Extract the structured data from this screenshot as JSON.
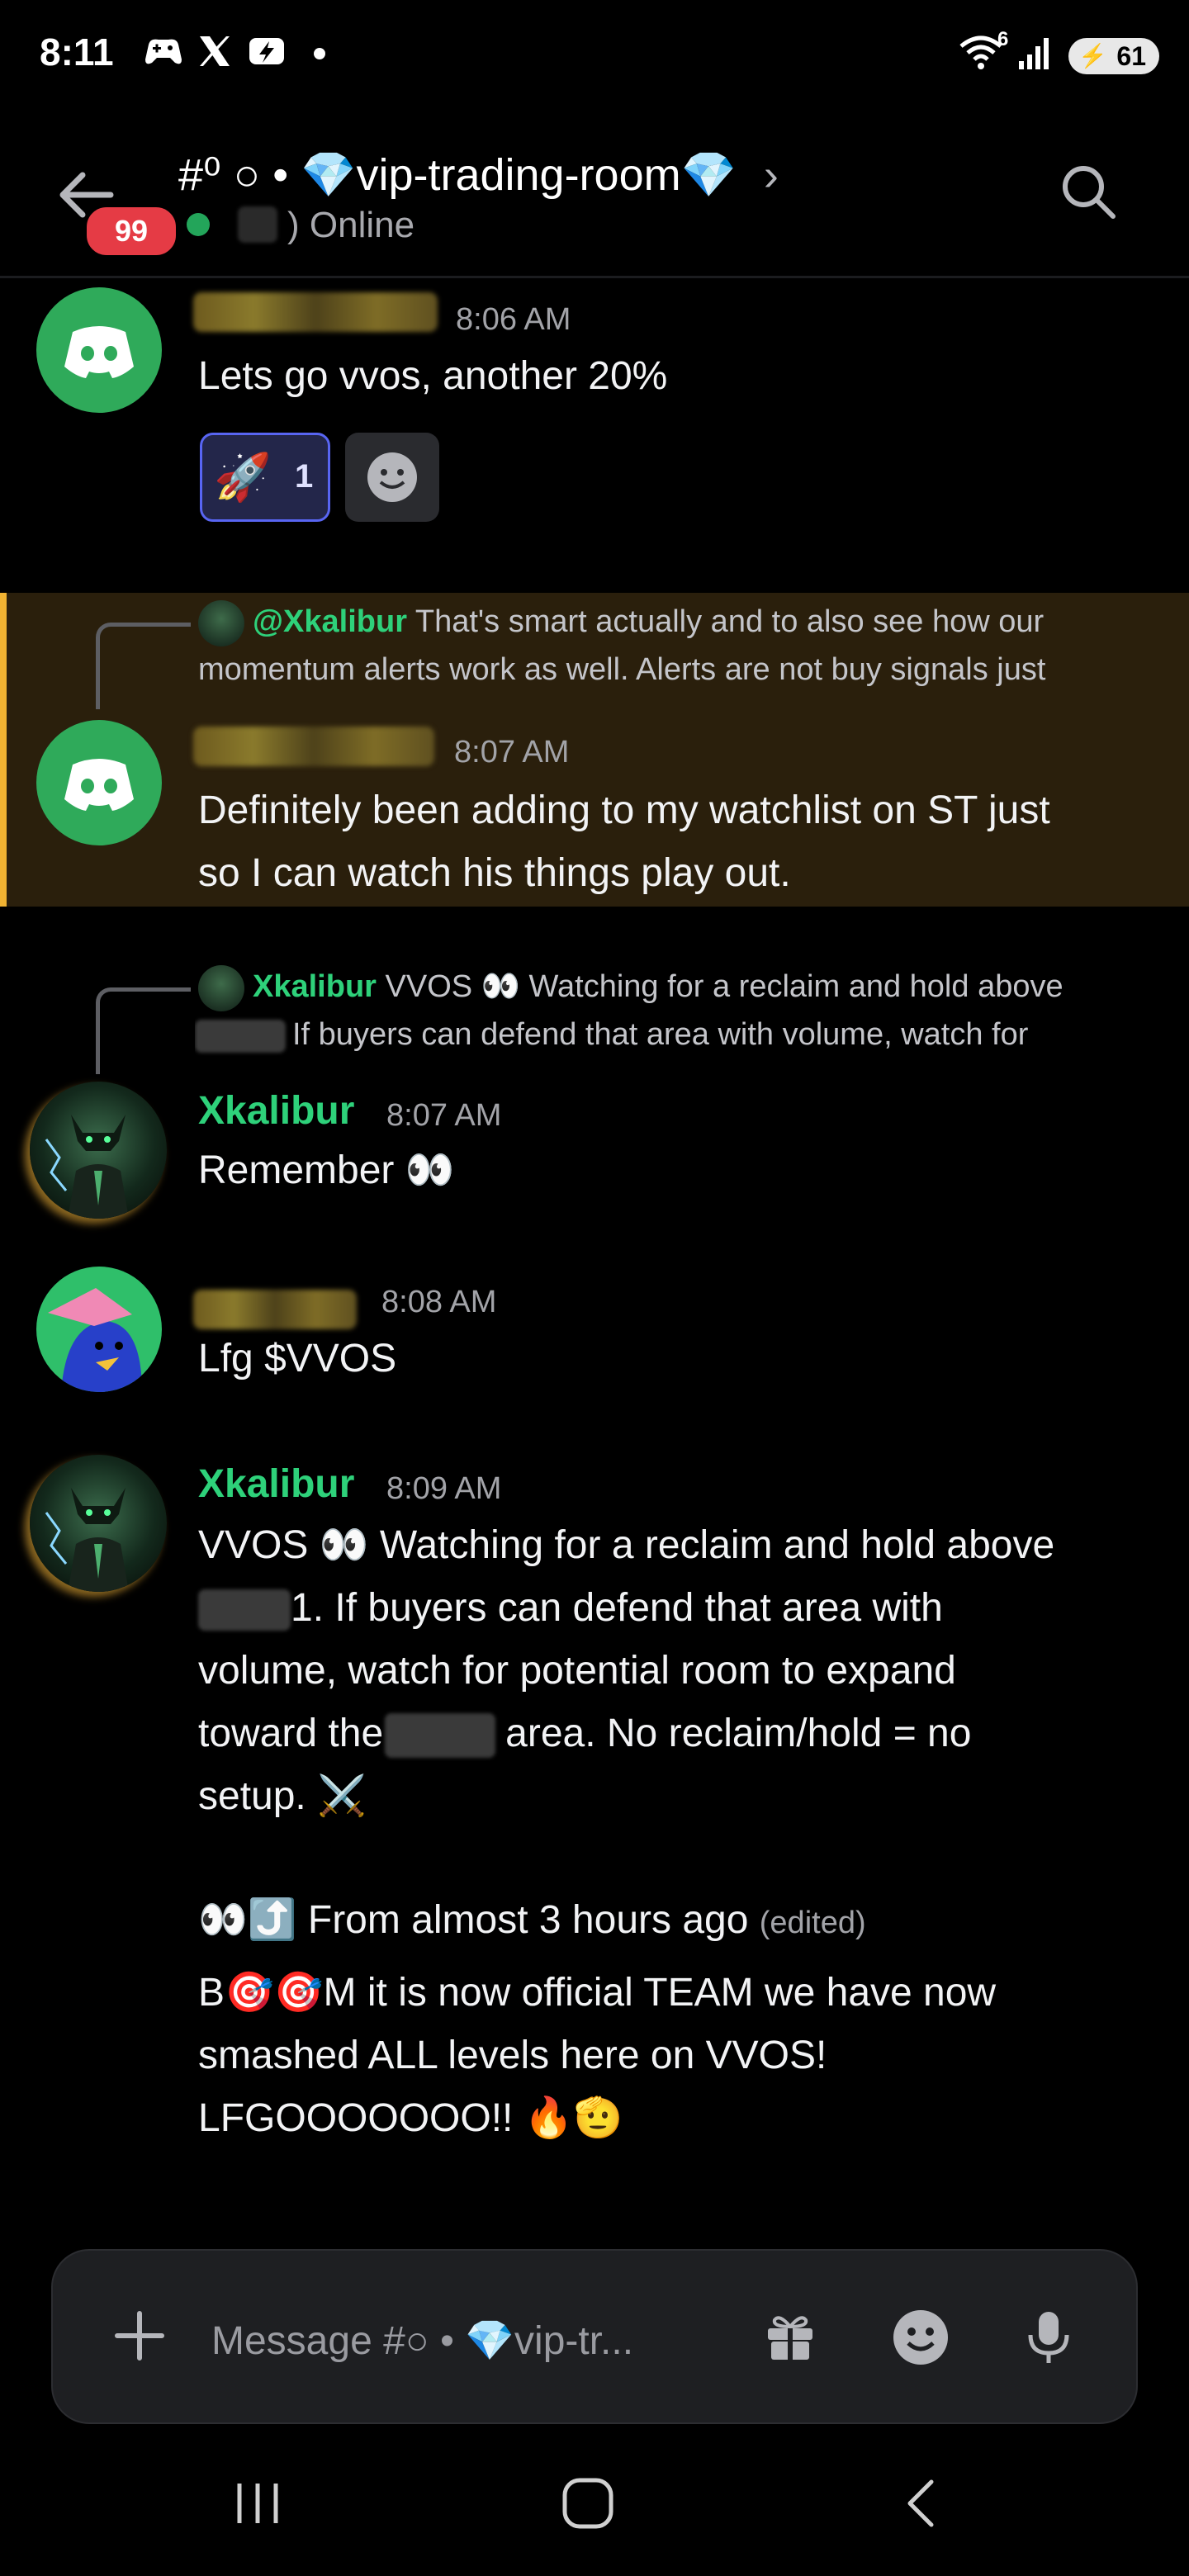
{
  "status_bar": {
    "time": "8:11",
    "signal_label": "6",
    "battery": "61"
  },
  "header": {
    "channel_name": "#⁰ ○ • 💎vip-trading-room💎",
    "unread_badge": "99",
    "online_text": ") Online"
  },
  "messages": [
    {
      "time": "8:06 AM",
      "text": "Lets go vvos, another 20%",
      "reaction": {
        "emoji": "🚀",
        "count": "1"
      }
    },
    {
      "reply": {
        "name": "@Xkalibur",
        "line1": "That's smart actually and to also see how our",
        "line2": "momentum alerts work as well. Alerts are not buy signals just"
      },
      "time": "8:07 AM",
      "lines": [
        "Definitely been adding to my watchlist on ST just",
        "so I can watch his things play out."
      ]
    },
    {
      "reply": {
        "name": "Xkalibur",
        "line1": "VVOS 👀 Watching for a reclaim and hold above",
        "line2": "If buyers can defend that area with volume, watch for"
      },
      "author": "Xkalibur",
      "time": "8:07 AM",
      "text": "Remember 👀"
    },
    {
      "time": "8:08 AM",
      "text": "Lfg $VVOS"
    },
    {
      "author": "Xkalibur",
      "time": "8:09 AM",
      "lines": [
        "VVOS 👀 Watching for a reclaim and hold above",
        "1. If buyers can defend that area with",
        "volume, watch for potential room to expand",
        "toward the",
        "area. No reclaim/hold = no",
        "setup. ⚔️"
      ],
      "update_lead": "👀⤴️ From almost 3 hours ago",
      "edited": "(edited)",
      "update_lines": [
        "B🎯🎯M it is now official TEAM we have now",
        "smashed ALL levels here on VVOS!",
        "LFGOOOOOOO!! 🔥🫡"
      ]
    }
  ],
  "composer": {
    "placeholder": "Message #○ • 💎vip-tr..."
  }
}
